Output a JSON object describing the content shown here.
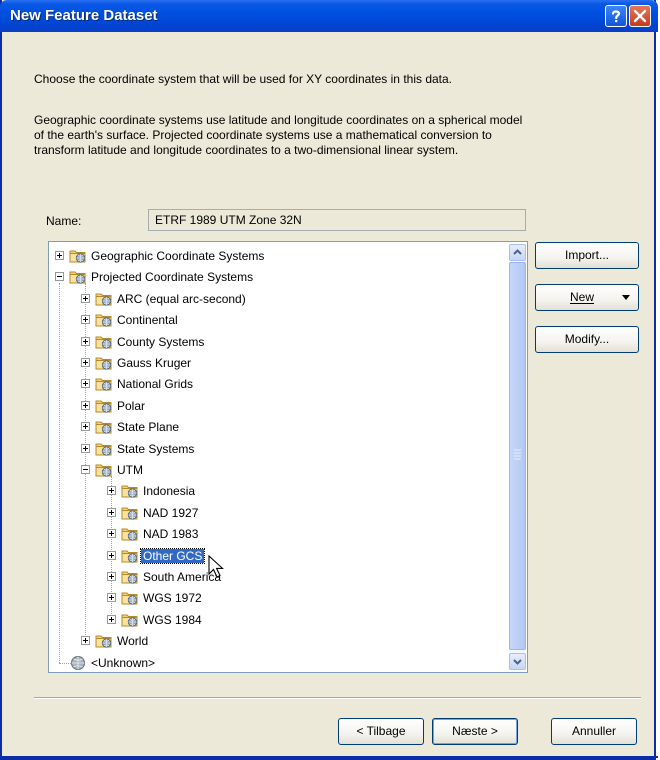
{
  "window": {
    "title": "New Feature Dataset"
  },
  "description": {
    "line1": "Choose the coordinate system that will be used for XY coordinates in this data.",
    "para2_line1": "Geographic coordinate systems use latitude and longitude coordinates on a spherical model",
    "para2_line2": "of the earth's surface. Projected coordinate systems use a mathematical conversion to",
    "para2_line3": "transform latitude and longitude coordinates to a two-dimensional linear system."
  },
  "name_field": {
    "label": "Name:",
    "value": "ETRF 1989 UTM Zone 32N"
  },
  "tree": {
    "items": [
      {
        "label": "Geographic Coordinate Systems",
        "level": 0,
        "expander": "plus",
        "icon": "folder-globe-icon"
      },
      {
        "label": "Projected Coordinate Systems",
        "level": 0,
        "expander": "minus",
        "icon": "folder-globe-icon"
      },
      {
        "label": "ARC (equal arc-second)",
        "level": 1,
        "expander": "plus",
        "icon": "folder-globe-icon"
      },
      {
        "label": "Continental",
        "level": 1,
        "expander": "plus",
        "icon": "folder-globe-icon"
      },
      {
        "label": "County Systems",
        "level": 1,
        "expander": "plus",
        "icon": "folder-globe-icon"
      },
      {
        "label": "Gauss Kruger",
        "level": 1,
        "expander": "plus",
        "icon": "folder-globe-icon"
      },
      {
        "label": "National Grids",
        "level": 1,
        "expander": "plus",
        "icon": "folder-globe-icon"
      },
      {
        "label": "Polar",
        "level": 1,
        "expander": "plus",
        "icon": "folder-globe-icon"
      },
      {
        "label": "State Plane",
        "level": 1,
        "expander": "plus",
        "icon": "folder-globe-icon"
      },
      {
        "label": "State Systems",
        "level": 1,
        "expander": "plus",
        "icon": "folder-globe-icon"
      },
      {
        "label": "UTM",
        "level": 1,
        "expander": "minus",
        "icon": "folder-globe-icon"
      },
      {
        "label": "Indonesia",
        "level": 2,
        "expander": "plus",
        "icon": "folder-globe-icon"
      },
      {
        "label": "NAD 1927",
        "level": 2,
        "expander": "plus",
        "icon": "folder-globe-icon"
      },
      {
        "label": "NAD 1983",
        "level": 2,
        "expander": "plus",
        "icon": "folder-globe-icon"
      },
      {
        "label": "Other GCS",
        "level": 2,
        "expander": "plus",
        "icon": "folder-globe-icon",
        "selected": true
      },
      {
        "label": "South America",
        "level": 2,
        "expander": "plus",
        "icon": "folder-globe-icon"
      },
      {
        "label": "WGS 1972",
        "level": 2,
        "expander": "plus",
        "icon": "folder-globe-icon"
      },
      {
        "label": "WGS 1984",
        "level": 2,
        "expander": "plus",
        "icon": "folder-globe-icon"
      },
      {
        "label": "World",
        "level": 1,
        "expander": "plus",
        "icon": "folder-globe-icon"
      },
      {
        "label": "<Unknown>",
        "level": 0,
        "expander": "none",
        "icon": "globe-icon"
      }
    ]
  },
  "side_buttons": {
    "import": "Import...",
    "new": "New",
    "modify": "Modify..."
  },
  "footer_buttons": {
    "back": "< Tilbage",
    "next": "Næste >",
    "cancel": "Annuller"
  },
  "colors": {
    "titlebar": "#0050e0",
    "selection": "#316ac5",
    "dialog_bg": "#ece9d8"
  }
}
